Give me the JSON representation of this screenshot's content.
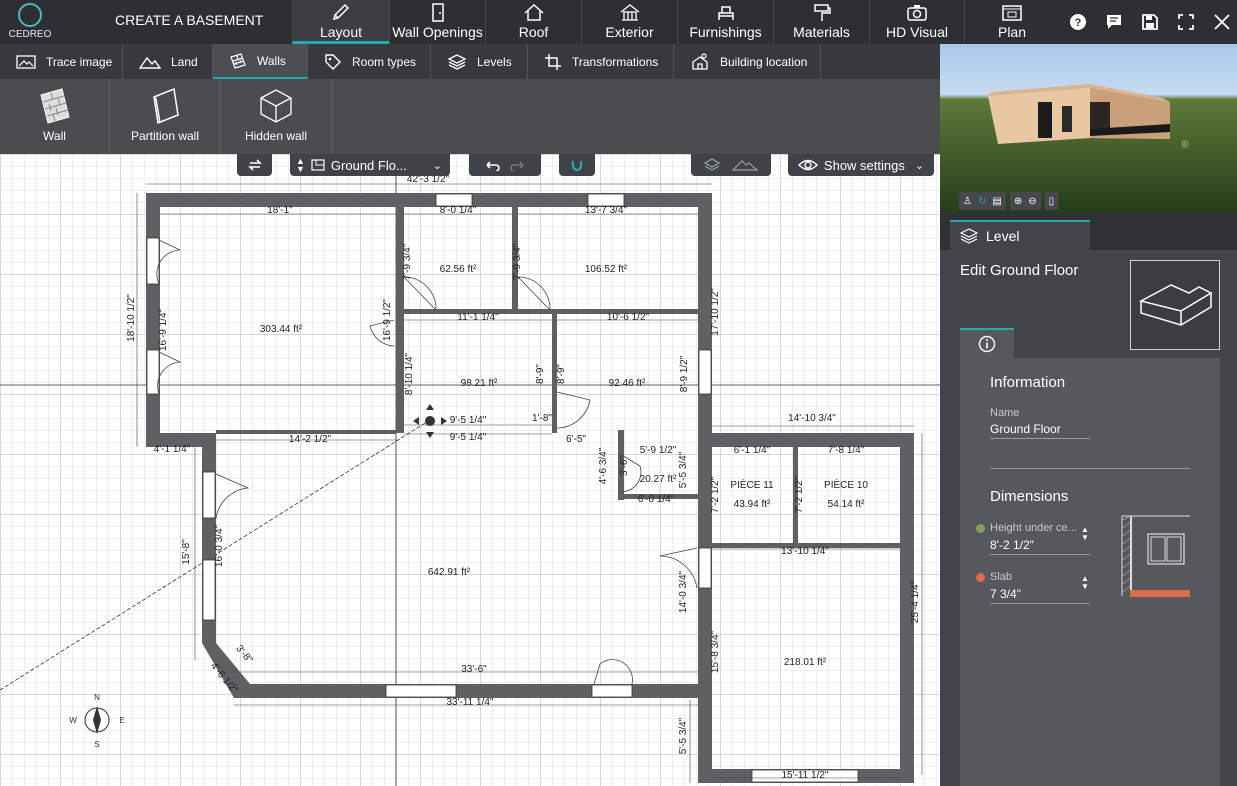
{
  "app": {
    "logo_text": "CEDREO",
    "project_title": "CREATE A BASEMENT"
  },
  "top_tabs": [
    {
      "label": "Layout",
      "icon": "pencil-icon"
    },
    {
      "label": "Wall Openings",
      "icon": "door-icon"
    },
    {
      "label": "Roof",
      "icon": "roof-icon"
    },
    {
      "label": "Exterior",
      "icon": "exterior-icon"
    },
    {
      "label": "Furnishings",
      "icon": "furniture-icon"
    },
    {
      "label": "Materials",
      "icon": "paint-roller-icon"
    },
    {
      "label": "HD Visual",
      "icon": "camera-icon"
    },
    {
      "label": "Plan",
      "icon": "plan-icon"
    }
  ],
  "top_right_icons": [
    "help-icon",
    "comment-icon",
    "save-icon",
    "fullscreen-icon",
    "close-icon"
  ],
  "sub_tabs": [
    {
      "label": "Trace image",
      "icon": "trace-image-icon"
    },
    {
      "label": "Land",
      "icon": "land-icon"
    },
    {
      "label": "Walls",
      "icon": "walls-icon"
    },
    {
      "label": "Room types",
      "icon": "tag-icon"
    },
    {
      "label": "Levels",
      "icon": "levels-icon"
    },
    {
      "label": "Transformations",
      "icon": "transform-icon"
    },
    {
      "label": "Building location",
      "icon": "building-location-icon"
    }
  ],
  "tools": [
    {
      "label": "Wall",
      "icon": "brick-wall-icon"
    },
    {
      "label": "Partition wall",
      "icon": "partition-wall-icon"
    },
    {
      "label": "Hidden wall",
      "icon": "hidden-wall-icon"
    }
  ],
  "canvas_controls": {
    "level_select": "Ground Flo...",
    "show_settings": "Show settings"
  },
  "compass": {
    "n": "N",
    "s": "S",
    "e": "E",
    "w": "W"
  },
  "plan": {
    "dims": [
      "42'-3 1/2\"",
      "18'-1\"",
      "8'-0 1/4\"",
      "13'-7 3/4\"",
      "18'-10 1/2\"",
      "16'-9 1/4\"",
      "16'-9 1/2\"",
      "7'-9 3/4\"",
      "7'-9 3/4\"",
      "17'-10 1/2\"",
      "11'-1 1/4\"",
      "10'-6 1/2\"",
      "8'-10 1/4\"",
      "8'-9\"",
      "8'-9\"",
      "8'-9 1/2\"",
      "9'-5 1/4\"",
      "1'-8\"",
      "9'-5 1/4\"",
      "14'-10 3/4\"",
      "4'-1 1/4\"",
      "14'-2 1/2\"",
      "6'-5\"",
      "5'-9 1/2\"",
      "6'-1 1/4\"",
      "7'-8 1/4\"",
      "4'-6 3/4\"",
      "3'-6\"",
      "5'-5 3/4\"",
      "6'-0 1/4\"",
      "7'-2 1/2\"",
      "7'-2 1/2\"",
      "13'-10 1/4\"",
      "15'-8\"",
      "16'-0 3/4\"",
      "14'-0 3/4\"",
      "25'-4 1/4\"",
      "15'-8 3/4\"",
      "3'-8\"",
      "4'-6 1/2\"",
      "33'-6\"",
      "33'-11 1/4\"",
      "5'-5 3/4\"",
      "15'-11 1/2\""
    ],
    "areas": [
      "303.44 ft²",
      "62.56 ft²",
      "106.52 ft²",
      "98.21 ft²",
      "92.46 ft²",
      "20.27 ft²",
      "642.91 ft²",
      "218.01 ft²",
      "43.94 ft²",
      "54.14 ft²"
    ],
    "room_names": [
      "PIÈCE 11",
      "PIÈCE 10"
    ]
  },
  "preview_toolbar": [
    "person-icon",
    "orbit-icon",
    "plan-view-icon",
    "zoom-in-icon",
    "zoom-out-icon",
    "mouse-icon"
  ],
  "right_panel": {
    "tab_label": "Level",
    "edit_title": "Edit Ground Floor",
    "info_section": "Information",
    "name_label": "Name",
    "name_value": "Ground Floor",
    "dimensions_section": "Dimensions",
    "height_label": "Height under ce...",
    "height_value": "8'-2 1/2\"",
    "slab_label": "Slab",
    "slab_value": "7 3/4\"",
    "height_color": "#8aa05a",
    "slab_color": "#e06a4e"
  },
  "colors": {
    "accent": "#2aa8b0",
    "wall": "#5f6062",
    "dark_bg": "#2d2f33"
  }
}
